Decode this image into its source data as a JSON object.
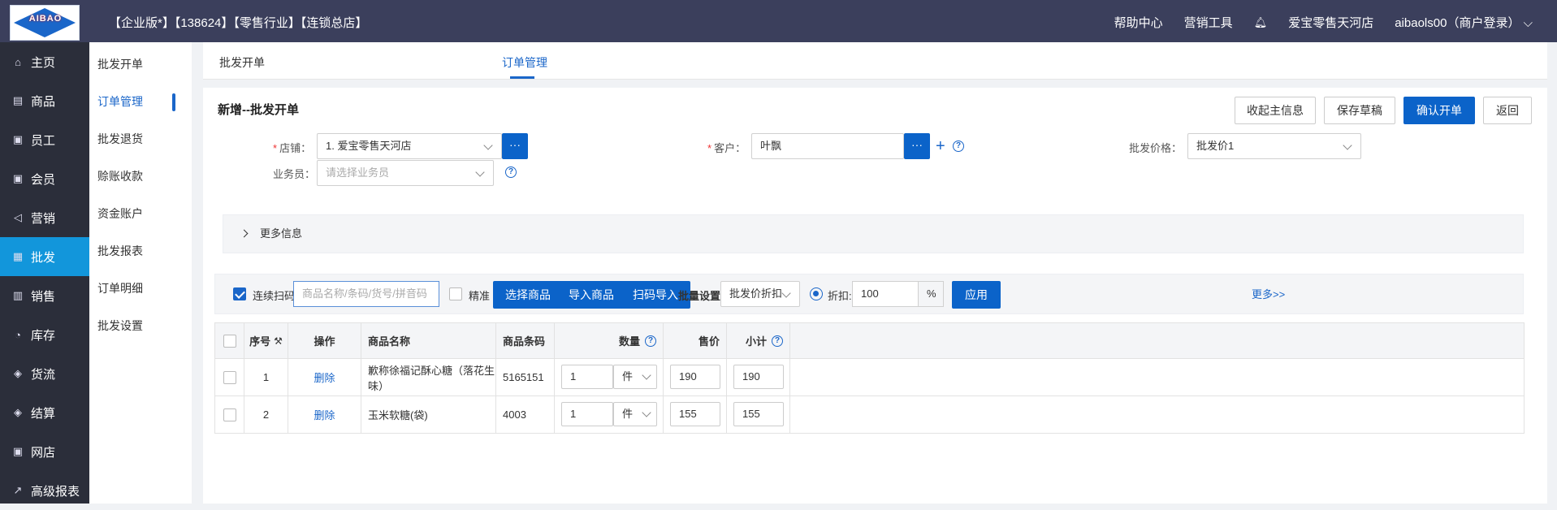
{
  "logo": {
    "text": "AIBAO",
    "sub": "爱 宝"
  },
  "topbar": {
    "info": "【企业版*】【138624】【零售行业】【连锁总店】",
    "help": "帮助中心",
    "marketing": "营销工具",
    "store": "爱宝零售天河店",
    "user": "aibaols00（商户登录）"
  },
  "sidebar": {
    "items": [
      {
        "label": "主页",
        "icon": "home-icon",
        "glyph": "⌂"
      },
      {
        "label": "商品",
        "icon": "goods-icon",
        "glyph": "▤"
      },
      {
        "label": "员工",
        "icon": "staff-icon",
        "glyph": "▣"
      },
      {
        "label": "会员",
        "icon": "member-icon",
        "glyph": "▣"
      },
      {
        "label": "营销",
        "icon": "marketing-icon",
        "glyph": "◁"
      },
      {
        "label": "批发",
        "icon": "wholesale-icon",
        "glyph": "▦"
      },
      {
        "label": "销售",
        "icon": "sales-icon",
        "glyph": "▥"
      },
      {
        "label": "库存",
        "icon": "stock-icon",
        "glyph": "◔"
      },
      {
        "label": "货流",
        "icon": "logistics-icon",
        "glyph": "◈"
      },
      {
        "label": "结算",
        "icon": "settle-icon",
        "glyph": "◈"
      },
      {
        "label": "网店",
        "icon": "shop-icon",
        "glyph": "▣"
      },
      {
        "label": "高级报表",
        "icon": "report-icon",
        "glyph": "↗"
      }
    ]
  },
  "submenu": {
    "items": [
      "批发开单",
      "订单管理",
      "批发退货",
      "赊账收款",
      "资金账户",
      "批发报表",
      "订单明细",
      "批发设置"
    ]
  },
  "tabs": [
    "批发开单",
    "订单管理"
  ],
  "page": {
    "title": "新增--批发开单",
    "collapse": "收起主信息",
    "draft": "保存草稿",
    "confirm": "确认开单",
    "back": "返回"
  },
  "form": {
    "store_label": "店铺：",
    "store_value": "1. 爱宝零售天河店",
    "customer_label": "客户：",
    "customer_value": "叶飘",
    "price_label": "批发价格：",
    "price_value": "批发价1",
    "salesman_label": "业务员：",
    "salesman_placeholder": "请选择业务员",
    "more_info": "更多信息"
  },
  "toolbar": {
    "continuous_scan": "连续扫码",
    "search_placeholder": "商品名称/条码/货号/拼音码",
    "exact": "精准",
    "select_goods": "选择商品",
    "import_goods": "导入商品",
    "scan_import": "扫码导入",
    "batch_label": "批量设置",
    "batch_value": "批发价折扣",
    "discount_label": "折扣:",
    "discount_value": "100",
    "percent": "%",
    "apply": "应用",
    "more": "更多>>"
  },
  "table": {
    "headers": {
      "seq": "序号",
      "action": "操作",
      "name": "商品名称",
      "barcode": "商品条码",
      "qty": "数量",
      "price": "售价",
      "subtotal": "小计"
    },
    "rows": [
      {
        "seq": "1",
        "action": "删除",
        "name": "歉称徐福记酥心糖（落花生味）",
        "barcode": "5165151",
        "qty": "1",
        "unit": "件",
        "price": "190",
        "subtotal": "190"
      },
      {
        "seq": "2",
        "action": "删除",
        "name": "玉米软糖(袋)",
        "barcode": "4003",
        "qty": "1",
        "unit": "件",
        "price": "155",
        "subtotal": "155"
      }
    ]
  },
  "colors": {
    "primary": "#0b63c9",
    "sidebar": "#2b2e3a",
    "topbar": "#3b3f5c",
    "active": "#1296db"
  }
}
